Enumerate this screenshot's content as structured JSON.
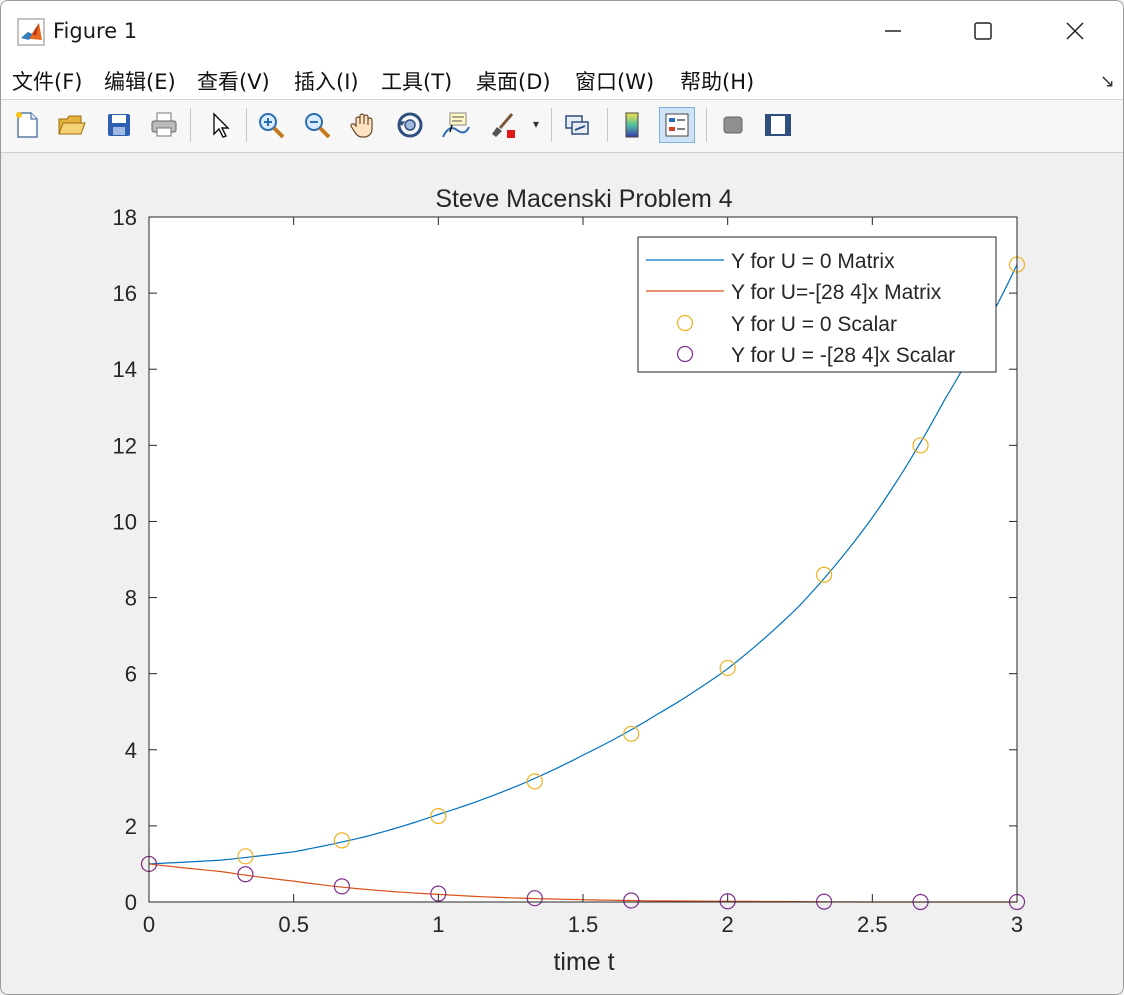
{
  "window": {
    "title": "Figure 1",
    "icon": "matlab-logo-icon"
  },
  "menu": {
    "items": [
      {
        "label": "文件(F)"
      },
      {
        "label": "编辑(E)"
      },
      {
        "label": "查看(V)"
      },
      {
        "label": "插入(I)"
      },
      {
        "label": "工具(T)"
      },
      {
        "label": "桌面(D)"
      },
      {
        "label": "窗口(W)"
      },
      {
        "label": "帮助(H)"
      }
    ],
    "overflow_icon": "dock-arrow-icon"
  },
  "toolbar": {
    "items": [
      {
        "name": "new-figure-icon"
      },
      {
        "name": "open-file-icon"
      },
      {
        "name": "save-icon"
      },
      {
        "name": "print-icon"
      },
      {
        "name": "select-pointer-icon"
      },
      {
        "name": "zoom-in-icon"
      },
      {
        "name": "zoom-out-icon"
      },
      {
        "name": "pan-hand-icon"
      },
      {
        "name": "rotate-3d-icon"
      },
      {
        "name": "data-cursor-icon"
      },
      {
        "name": "brush-icon"
      },
      {
        "name": "link-plot-icon"
      },
      {
        "name": "colorbar-icon"
      },
      {
        "name": "legend-icon",
        "active": true
      },
      {
        "name": "hide-plot-tools-icon"
      },
      {
        "name": "show-plot-tools-icon"
      }
    ]
  },
  "chart_data": {
    "type": "line",
    "title": "Steve Macenski Problem 4",
    "xlabel": "time t",
    "ylabel": "",
    "xlim": [
      0,
      3
    ],
    "ylim": [
      0,
      18
    ],
    "xticks": [
      "0",
      "0.5",
      "1",
      "1.5",
      "2",
      "2.5",
      "3"
    ],
    "yticks": [
      "0",
      "2",
      "4",
      "6",
      "8",
      "10",
      "12",
      "14",
      "16",
      "18"
    ],
    "legend_position": "top-right",
    "grid": false,
    "series": [
      {
        "name": "Y for U = 0 Matrix",
        "style": "line",
        "color": "#0072BD",
        "x": [
          0,
          0.25,
          0.5,
          0.75,
          1.0,
          1.25,
          1.5,
          1.75,
          2.0,
          2.25,
          2.5,
          2.75,
          3.0
        ],
        "y": [
          1.0,
          1.1,
          1.32,
          1.72,
          2.3,
          2.98,
          3.86,
          4.9,
          6.13,
          7.8,
          10.1,
          13.2,
          16.75
        ]
      },
      {
        "name": "Y for U=-[28 4]x Matrix",
        "style": "line",
        "color": "#D95319",
        "x": [
          0,
          0.25,
          0.5,
          0.75,
          1.0,
          1.25,
          1.5,
          1.75,
          2.0,
          2.25,
          2.5,
          2.75,
          3.0
        ],
        "y": [
          1.0,
          0.8,
          0.55,
          0.33,
          0.2,
          0.11,
          0.06,
          0.03,
          0.02,
          0.01,
          0.0,
          0.0,
          0.0
        ]
      },
      {
        "name": "Y for U = 0 Scalar",
        "style": "marker",
        "color": "#EDB120",
        "x": [
          0,
          0.3333,
          0.6667,
          1.0,
          1.3333,
          1.6667,
          2.0,
          2.3333,
          2.6667,
          3.0
        ],
        "y": [
          1.0,
          1.2,
          1.62,
          2.26,
          3.17,
          4.42,
          6.15,
          8.6,
          12.0,
          16.75
        ]
      },
      {
        "name": "Y for U = -[28 4]x Scalar",
        "style": "marker",
        "color": "#7E2F8E",
        "x": [
          0,
          0.3333,
          0.6667,
          1.0,
          1.3333,
          1.6667,
          2.0,
          2.3333,
          2.6667,
          3.0
        ],
        "y": [
          1.0,
          0.73,
          0.41,
          0.22,
          0.1,
          0.04,
          0.02,
          0.01,
          0.0,
          0.0
        ]
      }
    ]
  }
}
